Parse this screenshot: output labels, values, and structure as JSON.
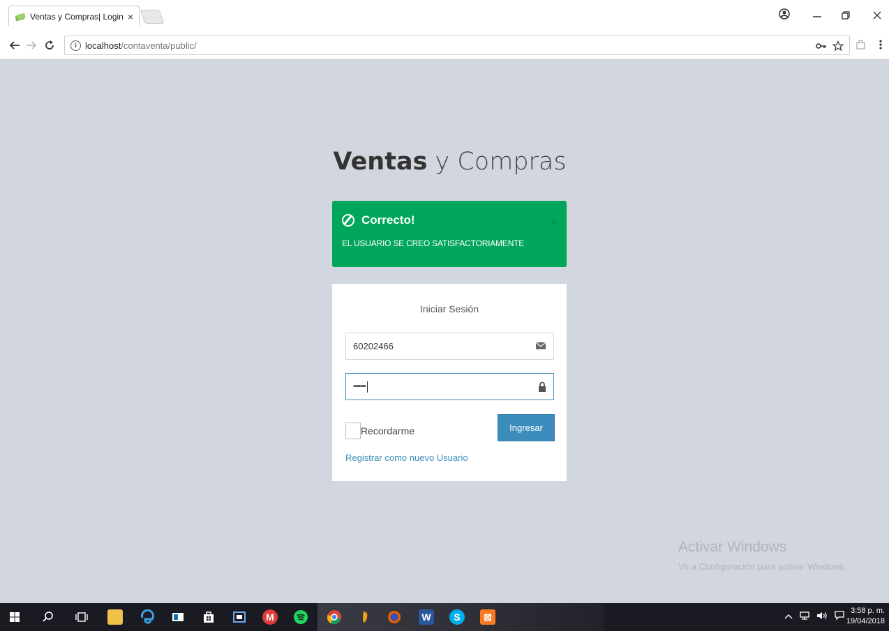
{
  "browser": {
    "tab_title": "Ventas y Compras| Login",
    "tab_close": "×",
    "url_host": "localhost",
    "url_path": "/contaventa/public/",
    "window_controls": [
      "minimize",
      "restore",
      "close"
    ]
  },
  "page": {
    "logo_bold": "Ventas",
    "logo_rest": " y Compras",
    "alert": {
      "title": "Correcto!",
      "message": "EL USUARIO SE CREO SATISFACTORIAMENTE",
      "close": "×",
      "color": "#00a65a"
    },
    "login": {
      "heading": "Iniciar Sesión",
      "email_value": "60202466",
      "password_value": "•••••••",
      "remember_label": "Recordarme",
      "submit_label": "Ingresar",
      "register_link": "Registrar como nuevo Usuario"
    }
  },
  "watermark": {
    "title": "Activar Windows",
    "subtitle": "Ve a Configuración para activar Windows."
  },
  "taskbar": {
    "time": "3:58 p. m.",
    "date": "19/04/2018"
  },
  "colors": {
    "background": "#d2d6de",
    "primary": "#3c8dbc",
    "success": "#00a65a"
  }
}
